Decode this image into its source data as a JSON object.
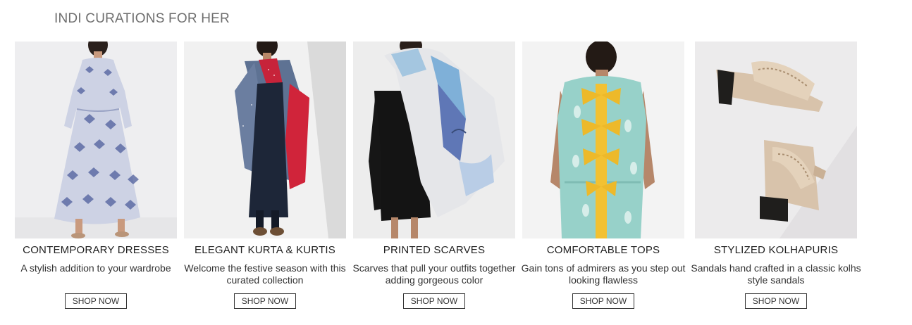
{
  "section": {
    "title": "INDI CURATIONS FOR HER"
  },
  "cards": [
    {
      "title": "CONTEMPORARY DRESSES",
      "desc": "A stylish addition to your wardrobe",
      "button": "SHOP NOW"
    },
    {
      "title": "ELEGANT KURTA & KURTIS",
      "desc": "Welcome the festive season with this curated collection",
      "button": "SHOP NOW"
    },
    {
      "title": "PRINTED SCARVES",
      "desc": "Scarves that pull your outfits together adding gorgeous color",
      "button": "SHOP NOW"
    },
    {
      "title": "COMFORTABLE TOPS",
      "desc": "Gain tons of admirers as you step out looking flawless",
      "button": "SHOP NOW"
    },
    {
      "title": "STYLIZED KOLHAPURIS",
      "desc": "Sandals hand crafted in a classic kolhs style sandals",
      "button": "SHOP NOW"
    }
  ]
}
